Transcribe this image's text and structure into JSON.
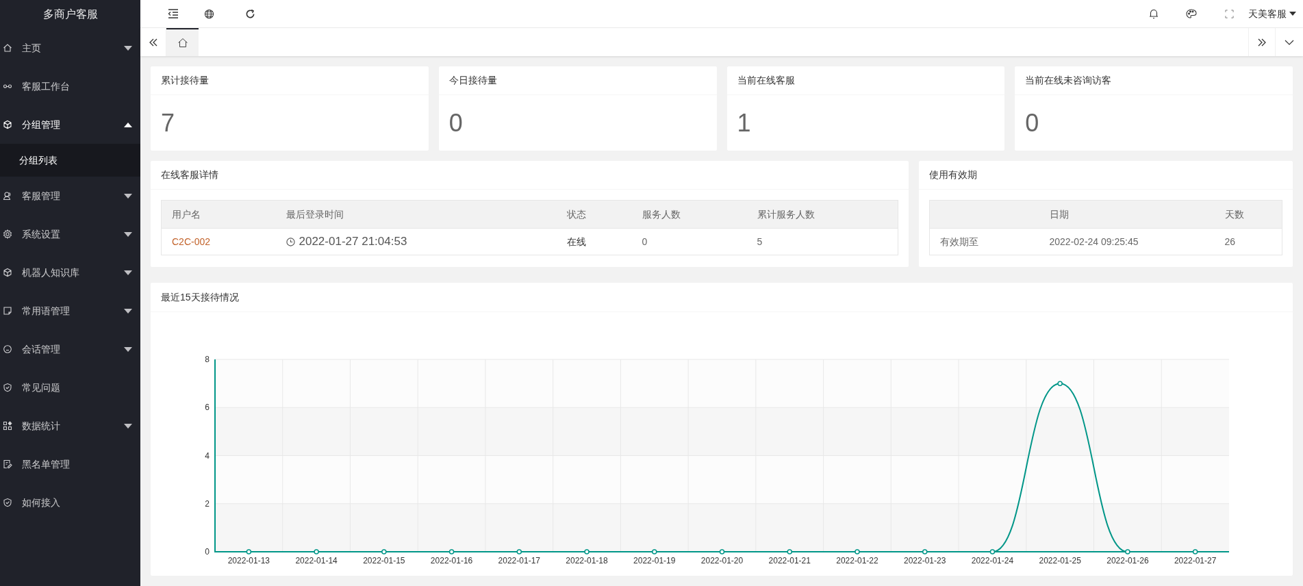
{
  "sidebar": {
    "title": "多商户客服",
    "items": [
      {
        "label": "主页",
        "expanded": false,
        "selected": false
      },
      {
        "label": "客服工作台",
        "selected": false
      },
      {
        "label": "分组管理",
        "expanded": true,
        "selected": false,
        "children": [
          {
            "label": "分组列表",
            "selected": true
          }
        ]
      },
      {
        "label": "客服管理",
        "expanded": false,
        "selected": false
      },
      {
        "label": "系统设置",
        "expanded": false,
        "selected": false
      },
      {
        "label": "机器人知识库",
        "expanded": false,
        "selected": false
      },
      {
        "label": "常用语管理",
        "expanded": false,
        "selected": false
      },
      {
        "label": "会话管理",
        "expanded": false,
        "selected": false
      },
      {
        "label": "常见问题",
        "selected": false
      },
      {
        "label": "数据统计",
        "expanded": false,
        "selected": false
      },
      {
        "label": "黑名单管理",
        "selected": false
      },
      {
        "label": "如何接入",
        "selected": false
      }
    ]
  },
  "header": {
    "user": "天美客服"
  },
  "tabs": [
    {
      "selected": true
    }
  ],
  "stats": [
    {
      "title": "累计接待量",
      "value": "7"
    },
    {
      "title": "今日接待量",
      "value": "0"
    },
    {
      "title": "当前在线客服",
      "value": "1"
    },
    {
      "title": "当前在线未咨询访客",
      "value": "0"
    }
  ],
  "online_panel": {
    "title": "在线客服详情",
    "columns": [
      "用户名",
      "最后登录时间",
      "状态",
      "服务人数",
      "累计服务人数"
    ],
    "rows": [
      [
        "C2C-002",
        "2022-01-27 21:04:53",
        "在线",
        "0",
        "5"
      ]
    ]
  },
  "validity_panel": {
    "title": "使用有效期",
    "columns": [
      "",
      "日期",
      "天数"
    ],
    "rows": [
      [
        "有效期至",
        "2022-02-24 09:25:45",
        "26"
      ]
    ]
  },
  "chart_panel": {
    "title": "最近15天接待情况",
    "chart_data": {
      "type": "line",
      "categories": [
        "2022-01-13",
        "2022-01-14",
        "2022-01-15",
        "2022-01-16",
        "2022-01-17",
        "2022-01-18",
        "2022-01-19",
        "2022-01-20",
        "2022-01-21",
        "2022-01-22",
        "2022-01-23",
        "2022-01-24",
        "2022-01-25",
        "2022-01-26",
        "2022-01-27"
      ],
      "grid": true,
      "series": [
        {
          "color": "#009688",
          "marker": "circle",
          "values": [
            0,
            0,
            0,
            0,
            0,
            0,
            0,
            0,
            0,
            0,
            0,
            0,
            7,
            0,
            0
          ]
        }
      ],
      "ylim": [
        0,
        8
      ],
      "yticks": [
        0,
        2,
        4,
        6,
        8
      ]
    }
  }
}
